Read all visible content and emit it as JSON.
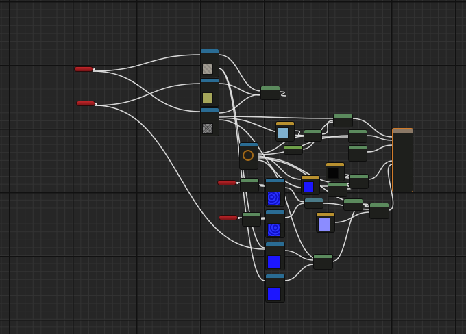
{
  "graph": {
    "name": "material-node-graph",
    "background": "#262626",
    "header_colors": {
      "texture": "#2a6c93",
      "math": "#5b8a5d",
      "constant": "#b8902f",
      "function": "#3f8f6b",
      "output": "#8a7866",
      "parameter": "#c2262a"
    },
    "wire_color": "#e6e6e6",
    "output_border": "#d17b2a",
    "swatches": {
      "stone": "#a09a8f",
      "moss": "#a6a75a",
      "gravel": "#6a6a6a",
      "lightblue": "#7fb1cf",
      "black": "#050505",
      "blue": "#1c16ff",
      "lavender": "#8b8cff",
      "noise": "#1a20e0"
    }
  }
}
